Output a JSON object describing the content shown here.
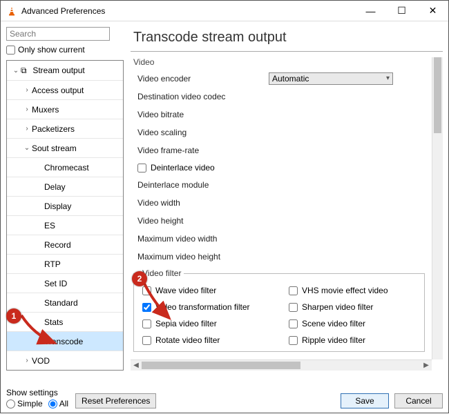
{
  "window": {
    "title": "Advanced Preferences",
    "min_icon": "—",
    "max_icon": "☐",
    "close_icon": "✕"
  },
  "search": {
    "placeholder": "Search"
  },
  "only_current_label": "Only show current",
  "tree": {
    "stream_output": "Stream output",
    "access_output": "Access output",
    "muxers": "Muxers",
    "packetizers": "Packetizers",
    "sout_stream": "Sout stream",
    "chromecast": "Chromecast",
    "delay": "Delay",
    "display": "Display",
    "es": "ES",
    "record": "Record",
    "rtp": "RTP",
    "set_id": "Set ID",
    "standard": "Standard",
    "stats": "Stats",
    "transcode": "Transcode",
    "vod": "VOD"
  },
  "heading": "Transcode stream output",
  "video_group": "Video",
  "rows": {
    "encoder_lbl": "Video encoder",
    "encoder_val": "Automatic",
    "dest_codec": "Destination video codec",
    "bitrate": "Video bitrate",
    "scaling": "Video scaling",
    "framerate": "Video frame-rate",
    "deinterlace": "Deinterlace video",
    "deint_module": "Deinterlace module",
    "width": "Video width",
    "height": "Video height",
    "max_width": "Maximum video width",
    "max_height": "Maximum video height"
  },
  "filter_legend": "Video filter",
  "filters": {
    "wave": "Wave video filter",
    "vhs": "VHS movie effect video",
    "transform": "Video transformation filter",
    "sharpen": "Sharpen video filter",
    "sepia": "Sepia video filter",
    "scene": "Scene video filter",
    "rotate": "Rotate video filter",
    "ripple": "Ripple video filter"
  },
  "footer": {
    "show_settings": "Show settings",
    "simple": "Simple",
    "all": "All",
    "reset": "Reset Preferences",
    "save": "Save",
    "cancel": "Cancel"
  },
  "annot": {
    "one": "1",
    "two": "2"
  }
}
